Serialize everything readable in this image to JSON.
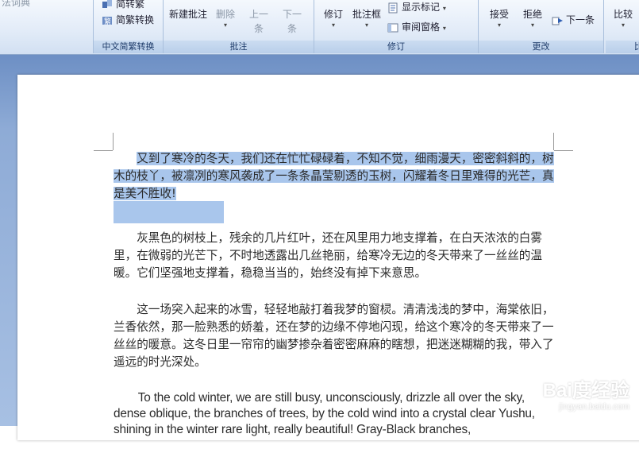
{
  "ribbon": {
    "partial_left_label": "法词典",
    "chinese_conversion": {
      "btn1": "简转繁",
      "btn2": "简繁转换",
      "label": "中文简繁转换"
    },
    "comments": {
      "new_comment": "新建批注",
      "delete": "删除",
      "previous": "上一条",
      "next": "下一条",
      "label": "批注"
    },
    "tracking": {
      "track": "修订",
      "balloons": "批注框",
      "show_markup": "显示标记",
      "reviewing_pane": "审阅窗格",
      "label": "修订"
    },
    "changes": {
      "accept": "接受",
      "reject": "拒绝",
      "next": "下一条",
      "label": "更改"
    },
    "compare": {
      "label": "比较",
      "partial": "比"
    }
  },
  "document": {
    "paragraphs": [
      {
        "selected": "又到了寒冷的冬天，我们还在忙忙碌碌着，不知不觉，细雨漫天，密密斜斜的，树木的枝丫，被凛冽的寒风袭成了一条条晶莹剔透的玉树，闪耀着冬日里难得的光芒，真是美不胜收!"
      },
      {
        "text": "灰黑色的树枝上，残余的几片红叶，还在风里用力地支撑着，在白天浓浓的白雾里，在微弱的光芒下，不时地透露出几丝艳丽，给寒冷无边的冬天带来了一丝丝的温暖。它们坚强地支撑着，稳稳当当的，始终没有掉下来意思。"
      },
      {
        "text": "这一场突入起来的冰雪，轻轻地敲打着我梦的窗棂。清清浅浅的梦中，海棠依旧，兰香依然，那一脸熟悉的娇羞，还在梦的边缘不停地闪现，给这个寒冷的冬天带来了一丝丝的暖意。这冬日里一帘帘的幽梦掺杂着密密麻麻的瞎想，把迷迷糊糊的我，带入了遥远的时光深处。"
      },
      {
        "text": "To the cold winter, we are still busy, unconsciously, drizzle all over the sky, dense oblique, the branches of trees, by the cold wind into a crystal clear Yushu, shining in the winter rare light, really beautiful! Gray-Black branches,"
      }
    ]
  },
  "watermark": {
    "main": "Bai度经验",
    "sub": "jingyan.baidu.com"
  }
}
